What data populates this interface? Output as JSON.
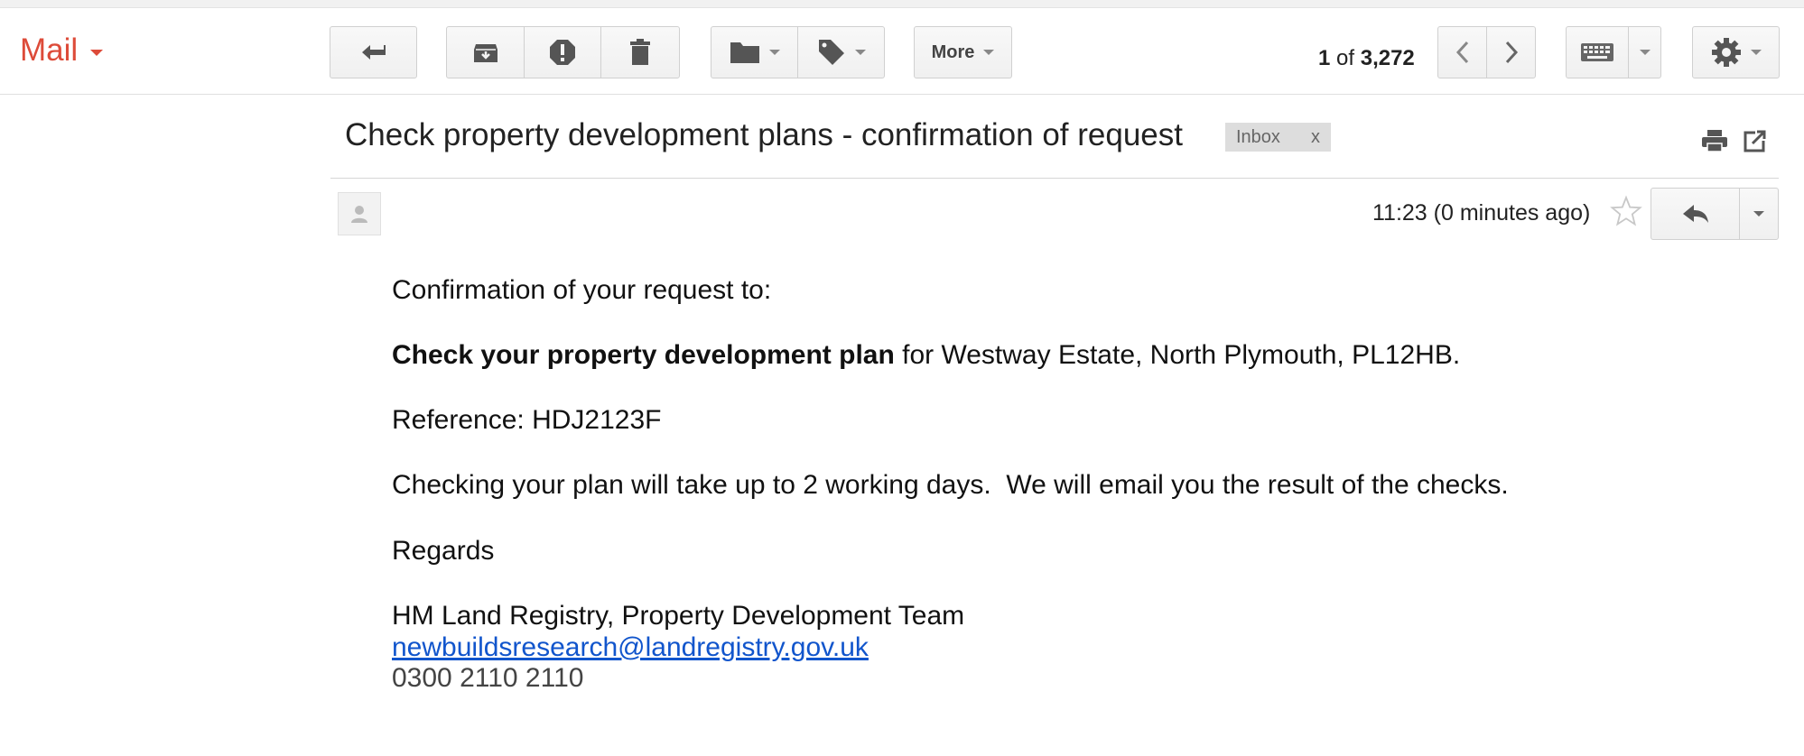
{
  "app": {
    "label": "Mail"
  },
  "toolbar": {
    "more_label": "More",
    "pager": {
      "current": "1",
      "of": "of",
      "total": "3,272"
    }
  },
  "message": {
    "subject": "Check property development plans - confirmation of request",
    "label_chip": "Inbox",
    "label_remove": "x",
    "time": "11:23 (0 minutes ago)",
    "body": {
      "intro": "Confirmation of your request to:",
      "service_bold": "Check your property development plan",
      "service_rest": " for Westway Estate, North Plymouth, PL12HB.",
      "reference": "Reference: HDJ2123F",
      "timeline": "Checking your plan will take up to 2 working days.  We will email you the result of the checks.",
      "regards": "Regards",
      "signature_org": "HM Land Registry, Property Development Team",
      "signature_email": "newbuildsresearch@landregistry.gov.uk",
      "signature_phone": "0300 2110 2110"
    }
  },
  "colors": {
    "mail_red": "#dd4b39",
    "link_blue": "#1155cc",
    "chip_gray": "#dddddd"
  },
  "icons": [
    "back-arrow-icon",
    "archive-icon",
    "report-spam-icon",
    "trash-icon",
    "folder-icon",
    "tag-icon",
    "chevron-left-icon",
    "chevron-right-icon",
    "keyboard-icon",
    "gear-icon",
    "print-icon",
    "new-window-icon",
    "person-icon",
    "star-icon",
    "reply-icon"
  ]
}
